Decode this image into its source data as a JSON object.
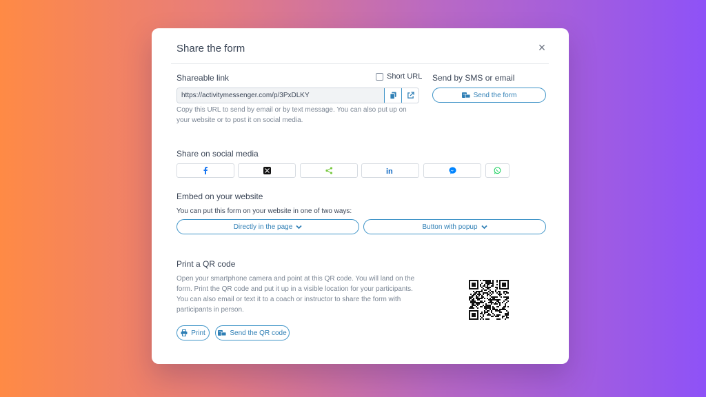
{
  "modal": {
    "title": "Share the form",
    "close_label": "×"
  },
  "shareable_link": {
    "label": "Shareable link",
    "short_url_label": "Short URL",
    "url_value": "https://activitymessenger.com/p/3PxDLKY",
    "help": "Copy this URL to send by email or by text message. You can also put up on your website or to post it on social media."
  },
  "sms_email": {
    "label": "Send by SMS or email",
    "button_label": "Send the form"
  },
  "social": {
    "label": "Share on social media",
    "items": [
      {
        "name": "facebook",
        "icon": "facebook-icon",
        "color": "#1877f2"
      },
      {
        "name": "x",
        "icon": "x-icon",
        "color": "#000000"
      },
      {
        "name": "share",
        "icon": "share-icon",
        "color": "#7ac943"
      },
      {
        "name": "linkedin",
        "icon": "linkedin-icon",
        "color": "#0a66c2"
      },
      {
        "name": "messenger",
        "icon": "messenger-icon",
        "color": "#0084ff"
      },
      {
        "name": "whatsapp",
        "icon": "whatsapp-icon",
        "color": "#25d366"
      }
    ]
  },
  "embed": {
    "label": "Embed on your website",
    "help": "You can put this form on your website in one of two ways:",
    "option_direct": "Directly in the page",
    "option_popup": "Button with popup"
  },
  "qr": {
    "label": "Print a QR code",
    "help": "Open your smartphone camera and point at this QR code. You will land on the form. Print the QR code and put it up in a visible location for your participants. You can also email or text it to a coach or instructor to share the form with participants in person.",
    "print_label": "Print",
    "send_label": "Send the QR code"
  },
  "colors": {
    "accent": "#2f7fb5",
    "text": "#3a4556",
    "muted": "#7b8694"
  }
}
